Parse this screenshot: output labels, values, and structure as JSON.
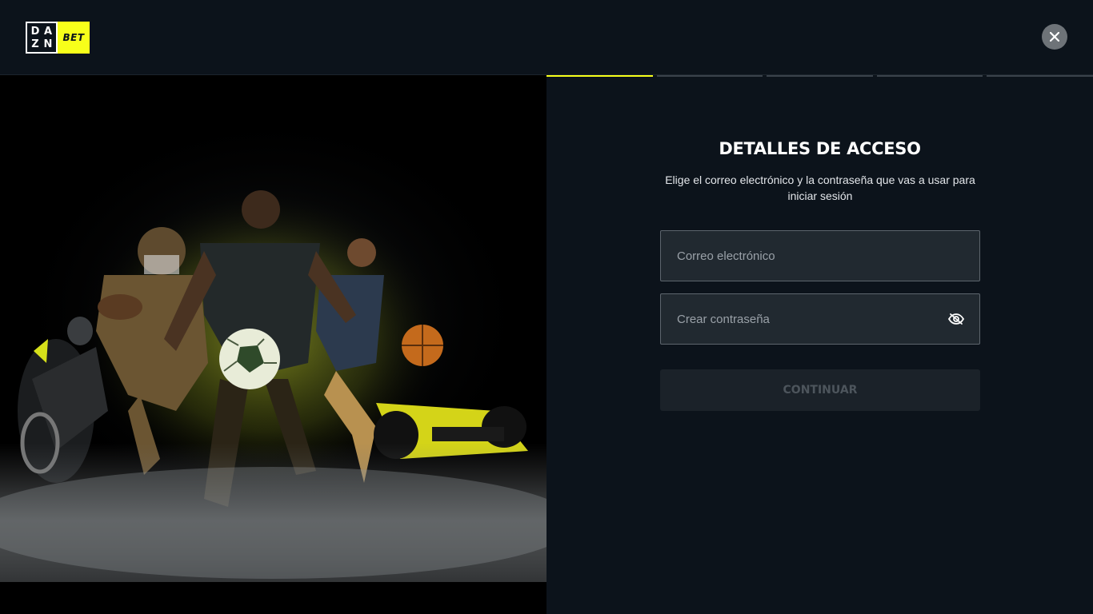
{
  "brand": {
    "logo_letters": [
      "D",
      "A",
      "Z",
      "N"
    ],
    "logo_suffix": "BET",
    "accent_color": "#f7ff1a"
  },
  "header": {
    "close_icon": "close-icon"
  },
  "progress": {
    "total_steps": 5,
    "current_step": 1
  },
  "form": {
    "title": "DETALLES DE ACCESO",
    "subtitle": "Elige el correo electrónico y la contraseña que vas a usar para iniciar sesión",
    "email": {
      "placeholder": "Correo electrónico",
      "value": ""
    },
    "password": {
      "placeholder": "Crear contraseña",
      "value": "",
      "toggle_icon": "eye-icon"
    },
    "continue_label": "CONTINUAR"
  },
  "hero": {
    "image_description_icon": "sports-athletes-illustration"
  }
}
